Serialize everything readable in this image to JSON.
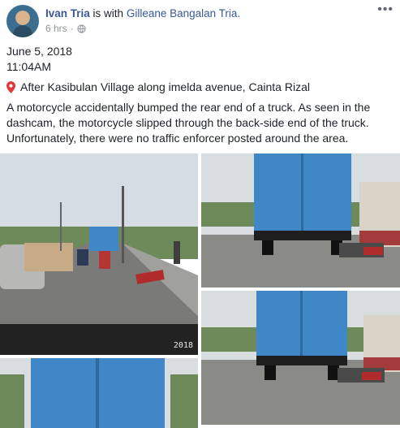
{
  "post": {
    "author": "Ivan Tria",
    "with_text": "is with",
    "tagged": "Gilleane Bangalan Tria.",
    "time_ago": "6 hrs",
    "separator": "·",
    "privacy_icon": "globe-icon",
    "menu_icon": "more-options-icon",
    "menu_glyph": "•••"
  },
  "content": {
    "date": "June 5, 2018",
    "time": "11:04AM",
    "location_icon": "pin-icon",
    "location": "After Kasibulan Village along imelda avenue, Cainta Rizal",
    "description": "A motorcycle accidentally bumped the rear end of a truck. As seen in the dashcam, the motorcycle slipped through the back-side end of the truck. Unfortunately, there were no traffic enforcer posted around the area."
  },
  "photos": {
    "stamp": "2018"
  },
  "colors": {
    "link": "#385898",
    "text": "#1d2129",
    "meta": "#90949c",
    "pin": "#e0393e",
    "container": "#3f87c7"
  }
}
